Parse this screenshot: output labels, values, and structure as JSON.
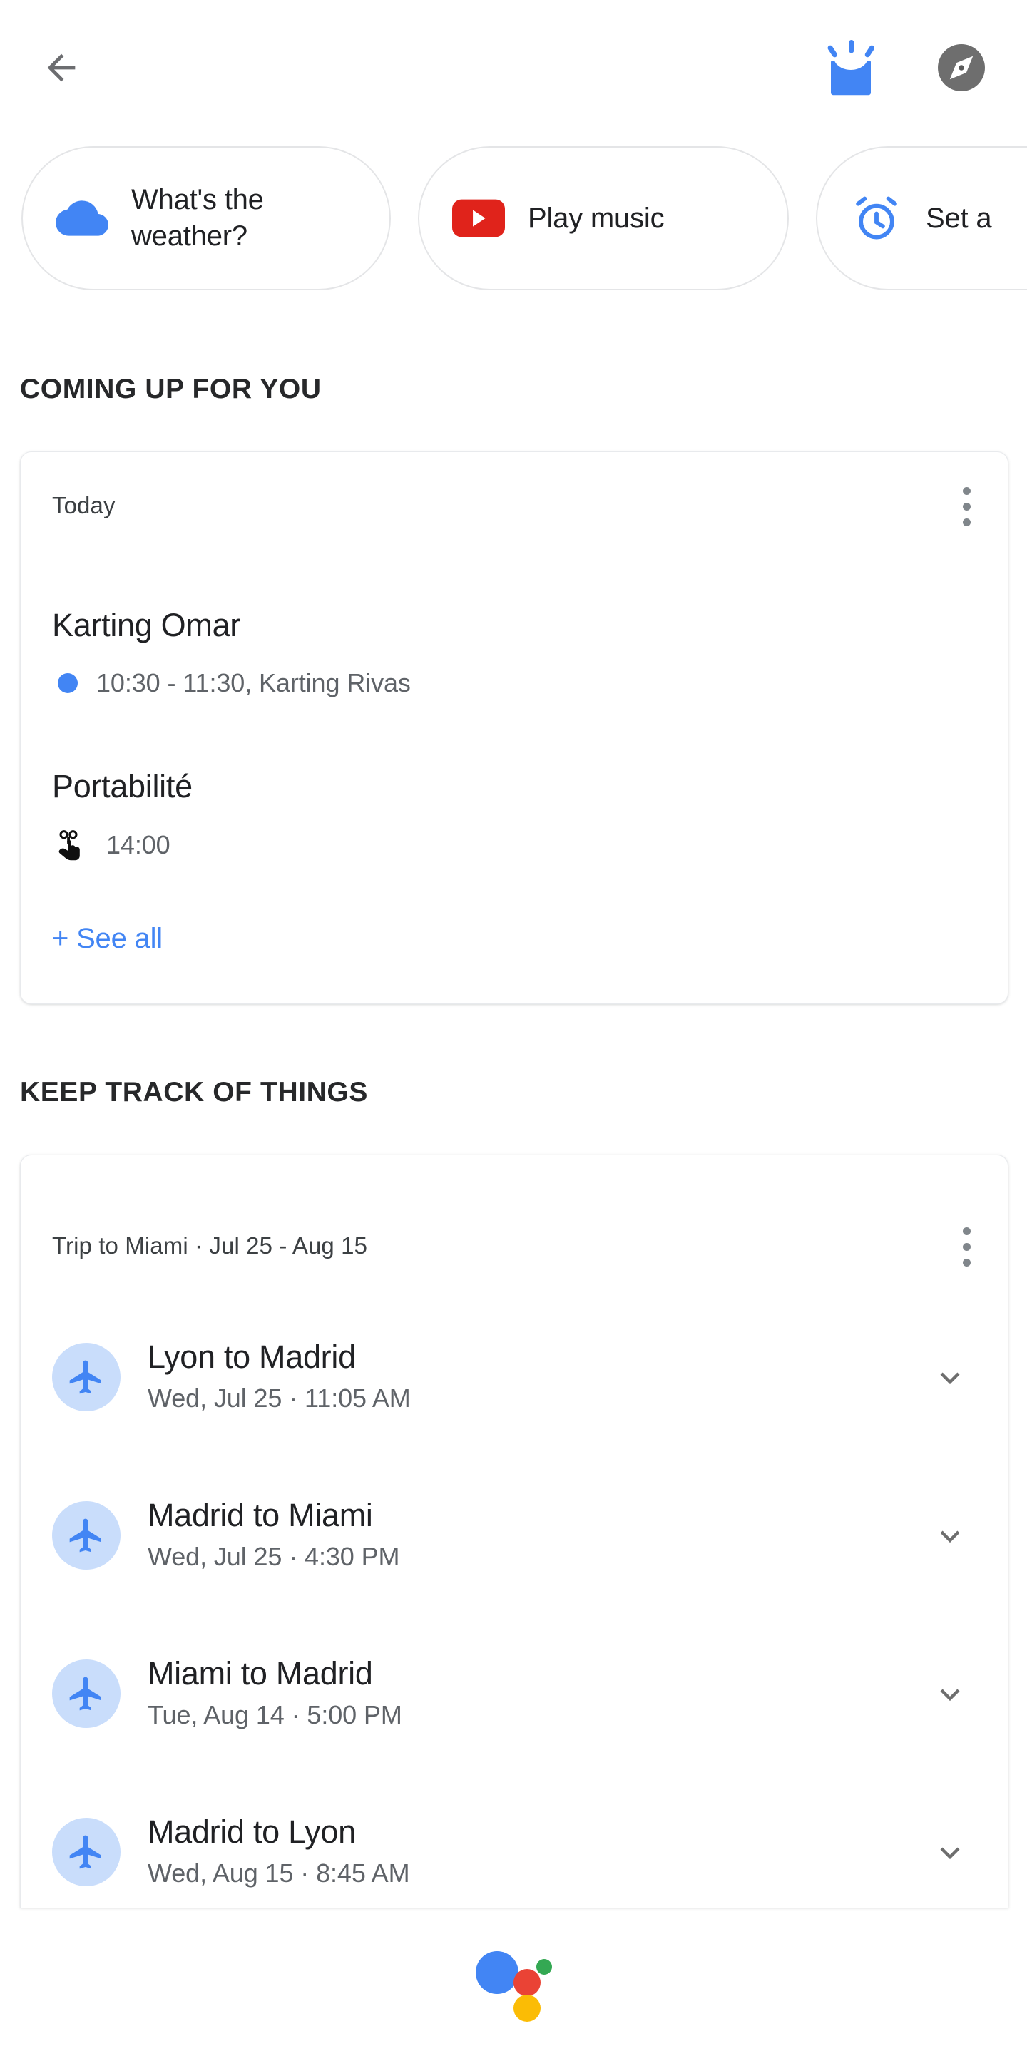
{
  "topbar": {
    "back_icon": "arrow-back-icon",
    "explore_icon": "assistant-snapshot-icon",
    "compass_icon": "explore-compass-icon"
  },
  "chips": [
    {
      "icon": "cloud-weather-icon",
      "label": "What's the\nweather?"
    },
    {
      "icon": "youtube-play-icon",
      "label": "Play music"
    },
    {
      "icon": "alarm-clock-icon",
      "label": "Set a"
    }
  ],
  "sections": {
    "coming_up": "COMING UP FOR YOU",
    "keep_track": "KEEP TRACK OF THINGS"
  },
  "today_card": {
    "meta": "Today",
    "menu_icon": "overflow-menu-icon",
    "events": [
      {
        "title": "Karting Omar",
        "marker": "calendar-dot-icon",
        "detail": "10:30 - 11:30, Karting Rivas"
      },
      {
        "title": "Portabilité",
        "marker": "reminder-finger-string-icon",
        "detail": "14:00"
      }
    ],
    "see_all": "+ See all"
  },
  "trip_card": {
    "meta": "Trip to Miami · Jul 25 - Aug 15",
    "menu_icon": "overflow-menu-icon",
    "flights": [
      {
        "icon": "airplane-icon",
        "title": "Lyon to Madrid",
        "sub": "Wed, Jul 25 · 11:05 AM",
        "expand_icon": "chevron-down-icon"
      },
      {
        "icon": "airplane-icon",
        "title": "Madrid to Miami",
        "sub": "Wed, Jul 25 · 4:30 PM",
        "expand_icon": "chevron-down-icon"
      },
      {
        "icon": "airplane-icon",
        "title": "Miami to Madrid",
        "sub": "Tue, Aug 14 · 5:00 PM",
        "expand_icon": "chevron-down-icon"
      },
      {
        "icon": "airplane-icon",
        "title": "Madrid to Lyon",
        "sub": "Wed, Aug 15 · 8:45 AM",
        "expand_icon": "chevron-down-icon"
      }
    ]
  },
  "assistant": {
    "icon": "google-assistant-dots-icon"
  },
  "colors": {
    "google_blue": "#4285f4",
    "google_red": "#ea4335",
    "google_yellow": "#fbbc05",
    "google_green": "#34a853",
    "youtube_red": "#e0231b",
    "avatar_blue": "#c9ddfb",
    "text_primary": "#202124",
    "text_secondary": "#5f6368",
    "compass_gray": "#6e6e6e"
  }
}
